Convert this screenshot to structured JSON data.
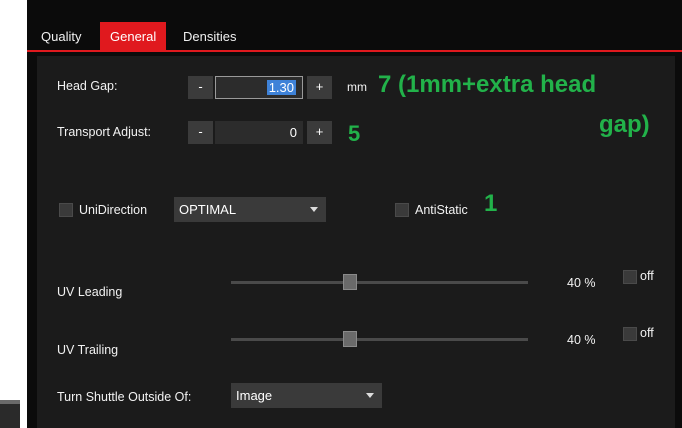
{
  "tabs": [
    {
      "label": "Quality",
      "active": false
    },
    {
      "label": "General",
      "active": true
    },
    {
      "label": "Densities",
      "active": false
    }
  ],
  "head_gap": {
    "label": "Head Gap:",
    "minus": "-",
    "value": "1.30",
    "plus": "+",
    "unit": "mm"
  },
  "transport_adjust": {
    "label": "Transport Adjust:",
    "minus": "-",
    "value": "0",
    "plus": "+"
  },
  "annotations": {
    "head_gap_line1": "7 (1mm+extra head",
    "head_gap_line2": "gap)",
    "transport": "5",
    "antistatic": "1",
    "color": "#22b24a"
  },
  "unidirection": {
    "label": "UniDirection",
    "checked": false,
    "selected": "OPTIMAL"
  },
  "antistatic": {
    "label": "AntiStatic",
    "checked": false
  },
  "uv_leading": {
    "label": "UV Leading",
    "percent_text": "40 %",
    "level": 0.4,
    "off_label": "off",
    "off_checked": false
  },
  "uv_trailing": {
    "label": "UV Trailing",
    "percent_text": "40 %",
    "level": 0.4,
    "off_label": "off",
    "off_checked": false
  },
  "turn_shuttle": {
    "label": "Turn Shuttle Outside Of:",
    "selected": "Image"
  },
  "colors": {
    "accent": "#e0191e",
    "panel_bg": "#1b1b1b",
    "selection": "#3e82d8"
  }
}
